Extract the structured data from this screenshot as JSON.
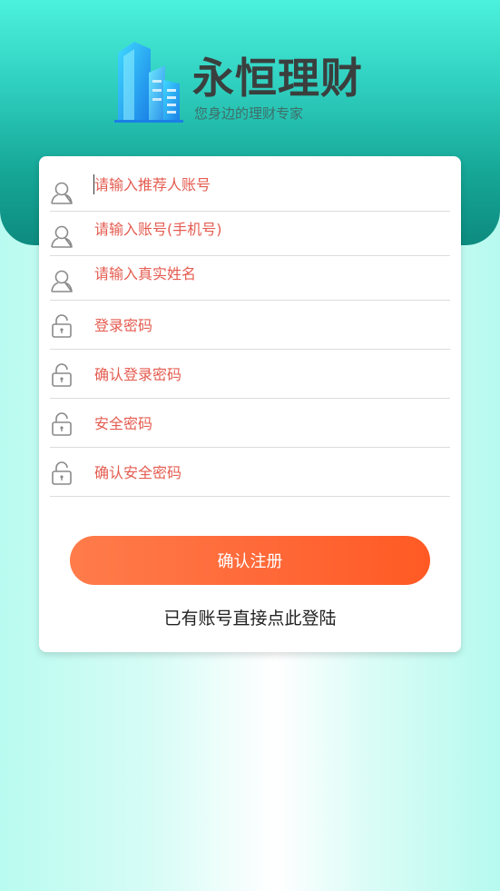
{
  "brand": {
    "title": "永恒理财",
    "subtitle": "您身边的理财专家",
    "logo_icon": "buildings-icon"
  },
  "form": {
    "fields": [
      {
        "name": "referrer-account",
        "icon": "user-icon",
        "placeholder": "请输入推荐人账号",
        "value": ""
      },
      {
        "name": "account-phone",
        "icon": "user-icon",
        "placeholder": "请输入账号(手机号)",
        "value": ""
      },
      {
        "name": "real-name",
        "icon": "user-icon",
        "placeholder": "请输入真实姓名",
        "value": ""
      },
      {
        "name": "login-password",
        "icon": "lock-icon",
        "placeholder": "登录密码",
        "value": ""
      },
      {
        "name": "confirm-login-password",
        "icon": "lock-icon",
        "placeholder": "确认登录密码",
        "value": ""
      },
      {
        "name": "security-password",
        "icon": "lock-icon",
        "placeholder": "安全密码",
        "value": ""
      },
      {
        "name": "confirm-security-password",
        "icon": "lock-icon",
        "placeholder": "确认安全密码",
        "value": ""
      }
    ],
    "submit_label": "确认注册",
    "login_link_label": "已有账号直接点此登陆"
  },
  "colors": {
    "placeholder": "#e45c50",
    "button_start": "#ff7c4a",
    "button_end": "#ff5a24",
    "header_top": "#4cf1dc",
    "header_bottom": "#0d8b7f"
  }
}
